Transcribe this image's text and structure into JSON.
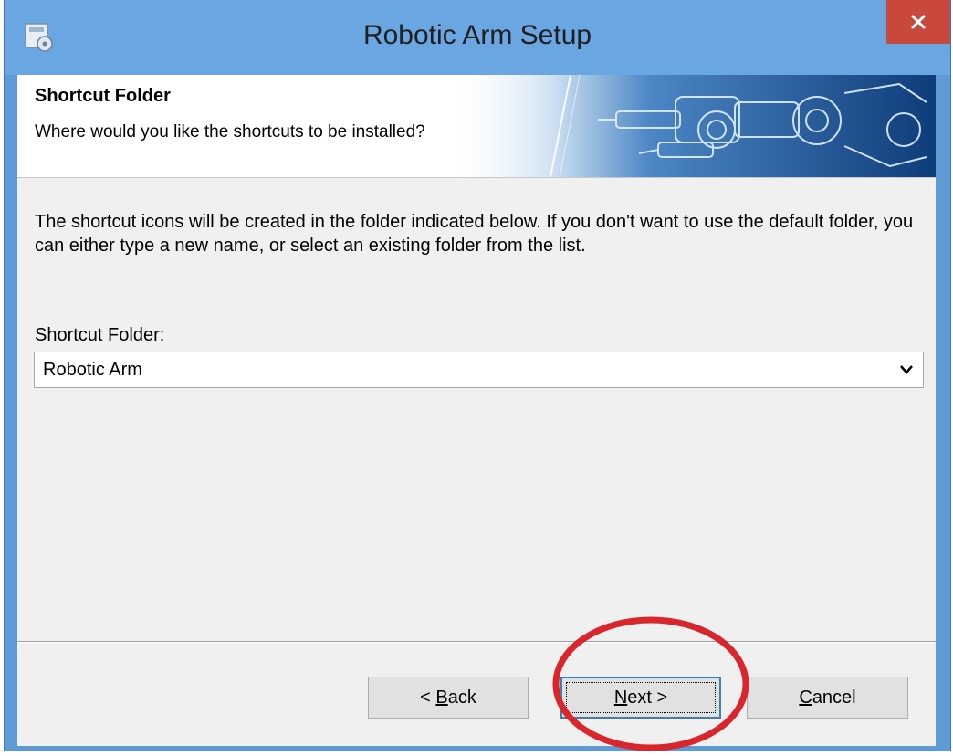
{
  "window": {
    "title": "Robotic Arm Setup",
    "app_icon": "setup-disk-icon",
    "close_icon": "close-icon",
    "close_button_color": "#c9483d"
  },
  "header": {
    "title": "Shortcut Folder",
    "subtitle": "Where would you like the shortcuts to be installed?",
    "banner_image": "robotic-arm-illustration"
  },
  "body": {
    "description": "The shortcut icons will be created in the folder indicated below. If you don't want to use the default folder, you can either type a new name, or select an existing folder from the list.",
    "folder_label": "Shortcut Folder:",
    "folder_value": "Robotic Arm"
  },
  "buttons": {
    "back": {
      "mnemonic": "B",
      "rest": "ack",
      "prefix": "< "
    },
    "next": {
      "mnemonic": "N",
      "rest": "ext >"
    },
    "cancel": {
      "mnemonic": "C",
      "rest": "ancel"
    }
  },
  "annotation": {
    "type": "circle-highlight",
    "target": "next-button",
    "color": "#d9262c"
  }
}
